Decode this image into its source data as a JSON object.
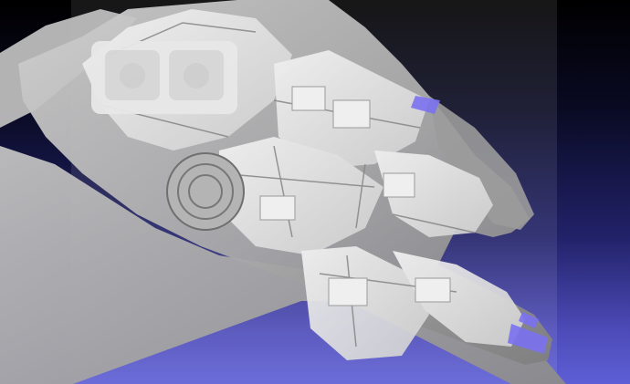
{
  "viewport": {
    "background_top": "#000000",
    "background_bottom": "#5e5fd6"
  },
  "model": {
    "subject": "spaceship-cutaway",
    "hull_color": "#b9b9b9",
    "interior_color": "#e6e6e6",
    "highlight_color": "#7b72f0"
  }
}
